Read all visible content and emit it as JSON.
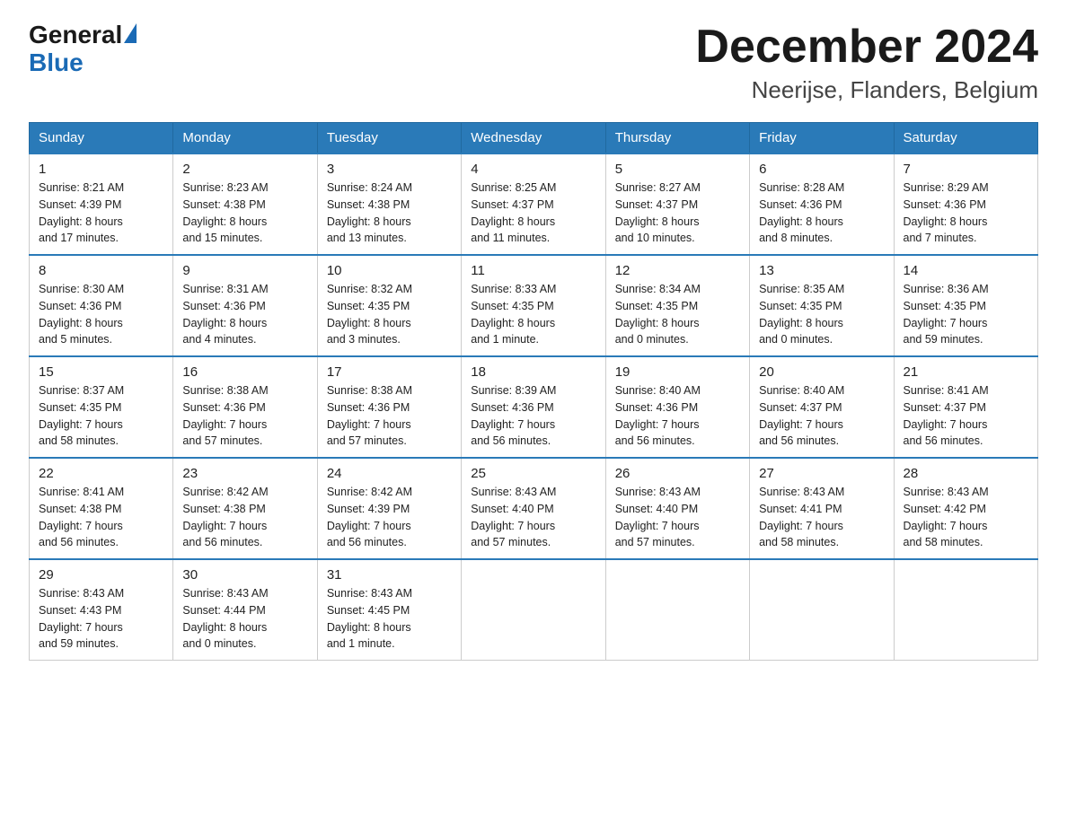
{
  "logo": {
    "general": "General",
    "blue": "Blue",
    "triangle": "▶"
  },
  "title": {
    "month_year": "December 2024",
    "location": "Neerijse, Flanders, Belgium"
  },
  "weekdays": [
    "Sunday",
    "Monday",
    "Tuesday",
    "Wednesday",
    "Thursday",
    "Friday",
    "Saturday"
  ],
  "weeks": [
    [
      {
        "day": "1",
        "sunrise": "8:21 AM",
        "sunset": "4:39 PM",
        "daylight": "8 hours and 17 minutes."
      },
      {
        "day": "2",
        "sunrise": "8:23 AM",
        "sunset": "4:38 PM",
        "daylight": "8 hours and 15 minutes."
      },
      {
        "day": "3",
        "sunrise": "8:24 AM",
        "sunset": "4:38 PM",
        "daylight": "8 hours and 13 minutes."
      },
      {
        "day": "4",
        "sunrise": "8:25 AM",
        "sunset": "4:37 PM",
        "daylight": "8 hours and 11 minutes."
      },
      {
        "day": "5",
        "sunrise": "8:27 AM",
        "sunset": "4:37 PM",
        "daylight": "8 hours and 10 minutes."
      },
      {
        "day": "6",
        "sunrise": "8:28 AM",
        "sunset": "4:36 PM",
        "daylight": "8 hours and 8 minutes."
      },
      {
        "day": "7",
        "sunrise": "8:29 AM",
        "sunset": "4:36 PM",
        "daylight": "8 hours and 7 minutes."
      }
    ],
    [
      {
        "day": "8",
        "sunrise": "8:30 AM",
        "sunset": "4:36 PM",
        "daylight": "8 hours and 5 minutes."
      },
      {
        "day": "9",
        "sunrise": "8:31 AM",
        "sunset": "4:36 PM",
        "daylight": "8 hours and 4 minutes."
      },
      {
        "day": "10",
        "sunrise": "8:32 AM",
        "sunset": "4:35 PM",
        "daylight": "8 hours and 3 minutes."
      },
      {
        "day": "11",
        "sunrise": "8:33 AM",
        "sunset": "4:35 PM",
        "daylight": "8 hours and 1 minute."
      },
      {
        "day": "12",
        "sunrise": "8:34 AM",
        "sunset": "4:35 PM",
        "daylight": "8 hours and 0 minutes."
      },
      {
        "day": "13",
        "sunrise": "8:35 AM",
        "sunset": "4:35 PM",
        "daylight": "8 hours and 0 minutes."
      },
      {
        "day": "14",
        "sunrise": "8:36 AM",
        "sunset": "4:35 PM",
        "daylight": "7 hours and 59 minutes."
      }
    ],
    [
      {
        "day": "15",
        "sunrise": "8:37 AM",
        "sunset": "4:35 PM",
        "daylight": "7 hours and 58 minutes."
      },
      {
        "day": "16",
        "sunrise": "8:38 AM",
        "sunset": "4:36 PM",
        "daylight": "7 hours and 57 minutes."
      },
      {
        "day": "17",
        "sunrise": "8:38 AM",
        "sunset": "4:36 PM",
        "daylight": "7 hours and 57 minutes."
      },
      {
        "day": "18",
        "sunrise": "8:39 AM",
        "sunset": "4:36 PM",
        "daylight": "7 hours and 56 minutes."
      },
      {
        "day": "19",
        "sunrise": "8:40 AM",
        "sunset": "4:36 PM",
        "daylight": "7 hours and 56 minutes."
      },
      {
        "day": "20",
        "sunrise": "8:40 AM",
        "sunset": "4:37 PM",
        "daylight": "7 hours and 56 minutes."
      },
      {
        "day": "21",
        "sunrise": "8:41 AM",
        "sunset": "4:37 PM",
        "daylight": "7 hours and 56 minutes."
      }
    ],
    [
      {
        "day": "22",
        "sunrise": "8:41 AM",
        "sunset": "4:38 PM",
        "daylight": "7 hours and 56 minutes."
      },
      {
        "day": "23",
        "sunrise": "8:42 AM",
        "sunset": "4:38 PM",
        "daylight": "7 hours and 56 minutes."
      },
      {
        "day": "24",
        "sunrise": "8:42 AM",
        "sunset": "4:39 PM",
        "daylight": "7 hours and 56 minutes."
      },
      {
        "day": "25",
        "sunrise": "8:43 AM",
        "sunset": "4:40 PM",
        "daylight": "7 hours and 57 minutes."
      },
      {
        "day": "26",
        "sunrise": "8:43 AM",
        "sunset": "4:40 PM",
        "daylight": "7 hours and 57 minutes."
      },
      {
        "day": "27",
        "sunrise": "8:43 AM",
        "sunset": "4:41 PM",
        "daylight": "7 hours and 58 minutes."
      },
      {
        "day": "28",
        "sunrise": "8:43 AM",
        "sunset": "4:42 PM",
        "daylight": "7 hours and 58 minutes."
      }
    ],
    [
      {
        "day": "29",
        "sunrise": "8:43 AM",
        "sunset": "4:43 PM",
        "daylight": "7 hours and 59 minutes."
      },
      {
        "day": "30",
        "sunrise": "8:43 AM",
        "sunset": "4:44 PM",
        "daylight": "8 hours and 0 minutes."
      },
      {
        "day": "31",
        "sunrise": "8:43 AM",
        "sunset": "4:45 PM",
        "daylight": "8 hours and 1 minute."
      },
      null,
      null,
      null,
      null
    ]
  ],
  "labels": {
    "sunrise": "Sunrise:",
    "sunset": "Sunset:",
    "daylight": "Daylight:"
  }
}
